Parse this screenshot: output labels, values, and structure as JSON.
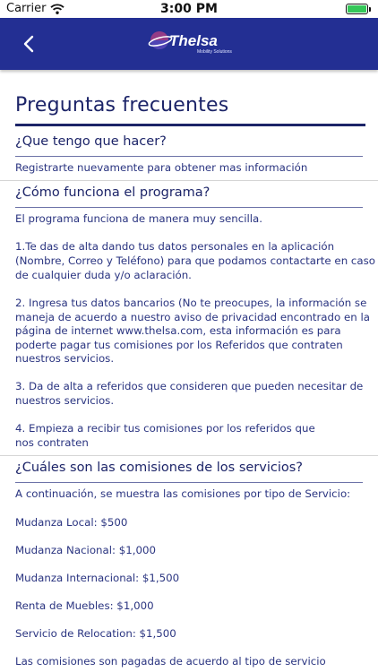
{
  "status_bar": {
    "carrier": "Carrier",
    "time": "3:00 PM",
    "battery_level": 1.0
  },
  "nav": {
    "logo_text": "Thelsa",
    "logo_tagline": "Mobility Solutions",
    "brand_color": "#232f93"
  },
  "page_title": "Preguntas frecuentes",
  "faq": {
    "q1": {
      "question": "¿Que tengo que hacer?",
      "answer": "Registrarte nuevamente para obtener mas información"
    },
    "q2": {
      "question": "¿Cómo funciona el programa?",
      "intro": "El programa funciona de manera muy sencilla.",
      "step1": [
        "1.Te das de alta dando tus datos personales en la aplicación",
        "(Nombre, Correo y Teléfono) para que podamos contactarte en caso",
        "de cualquier duda y/o aclaración."
      ],
      "step2": [
        "2. Ingresa tus datos bancarios (No te preocupes, la información se",
        "maneja de acuerdo a nuestro aviso de privacidad encontrado en la",
        "página de internet www.thelsa.com, esta información es para",
        "poderte pagar tus comisiones por los Referidos que contraten",
        "nuestros servicios."
      ],
      "step3": [
        "3. Da de alta a referidos que consideren que pueden necesitar de",
        "nuestros servicios."
      ],
      "step4": [
        "4. Empieza a recibir tus comisiones por los referidos que",
        "nos contraten"
      ]
    },
    "q3": {
      "question": "¿Cuáles son las comisiones de los servicios?",
      "intro": "A continuación, se muestra las comisiones por tipo de Servicio:",
      "items": [
        "Mudanza Local: $500",
        "Mudanza Nacional: $1,000",
        "Mudanza Internacional: $1,500",
        "Renta de Muebles: $1,000",
        "Servicio de Relocation: $1,500"
      ],
      "footer": "Las comisiones son pagadas de acuerdo al tipo de servicio"
    }
  }
}
